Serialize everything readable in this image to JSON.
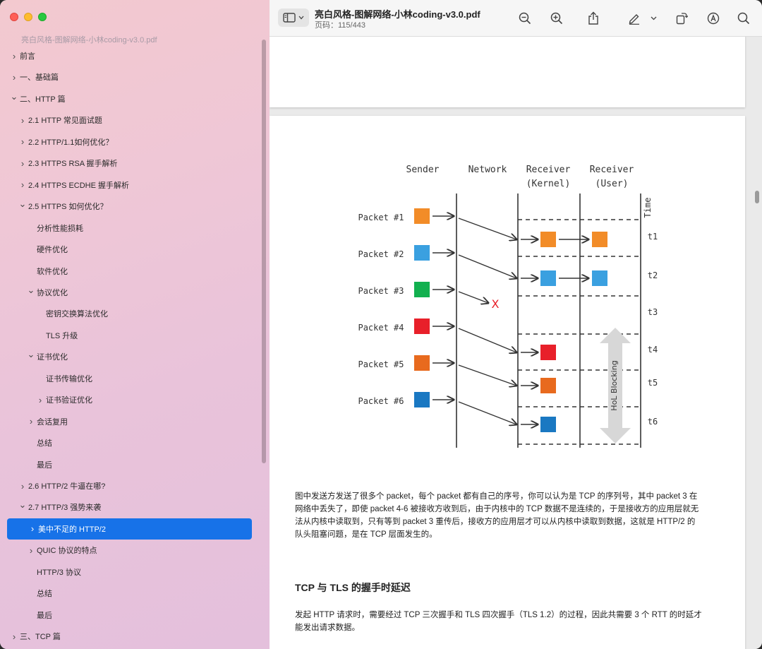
{
  "sidebar": {
    "doc_title": "亮白风格-图解网络-小林coding-v3.0.pdf",
    "items": [
      {
        "label": "前言",
        "level": 0,
        "chevron": "right"
      },
      {
        "label": "一、基础篇",
        "level": 0,
        "chevron": "right"
      },
      {
        "label": "二、HTTP 篇",
        "level": 0,
        "chevron": "down"
      },
      {
        "label": "2.1 HTTP 常见面试题",
        "level": 1,
        "chevron": "right"
      },
      {
        "label": "2.2 HTTP/1.1如何优化？",
        "level": 1,
        "chevron": "right"
      },
      {
        "label": "2.3 HTTPS RSA 握手解析",
        "level": 1,
        "chevron": "right"
      },
      {
        "label": "2.4 HTTPS ECDHE 握手解析",
        "level": 1,
        "chevron": "right"
      },
      {
        "label": "2.5 HTTPS 如何优化？",
        "level": 1,
        "chevron": "down"
      },
      {
        "label": "分析性能损耗",
        "level": 2,
        "chevron": "none"
      },
      {
        "label": "硬件优化",
        "level": 2,
        "chevron": "none"
      },
      {
        "label": "软件优化",
        "level": 2,
        "chevron": "none"
      },
      {
        "label": "协议优化",
        "level": 2,
        "chevron": "down"
      },
      {
        "label": "密钥交换算法优化",
        "level": 3,
        "chevron": "none"
      },
      {
        "label": "TLS 升级",
        "level": 3,
        "chevron": "none"
      },
      {
        "label": "证书优化",
        "level": 2,
        "chevron": "down"
      },
      {
        "label": "证书传输优化",
        "level": 3,
        "chevron": "none"
      },
      {
        "label": "证书验证优化",
        "level": 3,
        "chevron": "right"
      },
      {
        "label": "会话复用",
        "level": 2,
        "chevron": "right"
      },
      {
        "label": "总结",
        "level": 2,
        "chevron": "none"
      },
      {
        "label": "最后",
        "level": 2,
        "chevron": "none"
      },
      {
        "label": "2.6 HTTP/2 牛逼在哪?",
        "level": 1,
        "chevron": "right"
      },
      {
        "label": "2.7 HTTP/3 强势来袭",
        "level": 1,
        "chevron": "down"
      },
      {
        "label": "美中不足的 HTTP/2",
        "level": 2,
        "chevron": "right",
        "selected": true
      },
      {
        "label": "QUIC 协议的特点",
        "level": 2,
        "chevron": "right"
      },
      {
        "label": "HTTP/3 协议",
        "level": 2,
        "chevron": "none"
      },
      {
        "label": "总结",
        "level": 2,
        "chevron": "none"
      },
      {
        "label": "最后",
        "level": 2,
        "chevron": "none"
      },
      {
        "label": "三、TCP 篇",
        "level": 0,
        "chevron": "right"
      }
    ]
  },
  "toolbar": {
    "title": "亮白风格-图解网络-小林coding-v3.0.pdf",
    "page_label": "页码：",
    "page_current": "115",
    "page_total": "443",
    "page_text": "页码：115/443",
    "icons": [
      "sidebar-toggle-icon",
      "zoom-out-icon",
      "zoom-in-icon",
      "share-icon",
      "markup-pen-icon",
      "chevron-down-icon",
      "rotate-icon",
      "annotate-icon",
      "search-icon"
    ]
  },
  "document": {
    "diagram": {
      "columns": [
        "Sender",
        "Network",
        "Receiver",
        "(Kernel)",
        "Receiver",
        "(User)"
      ],
      "time_label": "Time",
      "packets": [
        "Packet #1",
        "Packet #2",
        "Packet #3",
        "Packet #4",
        "Packet #5",
        "Packet #6"
      ],
      "packet_colors": [
        "#f28c28",
        "#3aa0e0",
        "#12b04f",
        "#e8202a",
        "#e86a1e",
        "#1a78c2"
      ],
      "ticks": [
        "t1",
        "t2",
        "t3",
        "t4",
        "t5",
        "t6"
      ],
      "hol_label": "HoL Blocking",
      "lost_mark": "X"
    },
    "paragraph1_lines": [
      "图中发送方发送了很多个 packet，每个 packet 都有自己的序号，你可以认为是 TCP 的序列号，其中 packet 3 在",
      "网络中丢失了，即使 packet 4-6 被接收方收到后，由于内核中的 TCP 数据不是连续的，于是接收方的应用层就无",
      "法从内核中读取到，只有等到 packet 3 重传后，接收方的应用层才可以从内核中读取到数据，这就是 HTTP/2 的",
      "队头阻塞问题，是在 TCP 层面发生的。"
    ],
    "section_heading": "TCP 与 TLS 的握手时延迟",
    "paragraph2_lines": [
      "发起 HTTP 请求时，需要经过 TCP  三次握手和 TLS 四次握手（TLS 1.2）的过程，因此共需要 3 个 RTT 的时延才",
      "能发出请求数据。"
    ]
  },
  "colors": {
    "selection": "#1772e8",
    "sidebar_gradient_start": "#f3c9cf",
    "sidebar_gradient_end": "#e4c0dc"
  }
}
